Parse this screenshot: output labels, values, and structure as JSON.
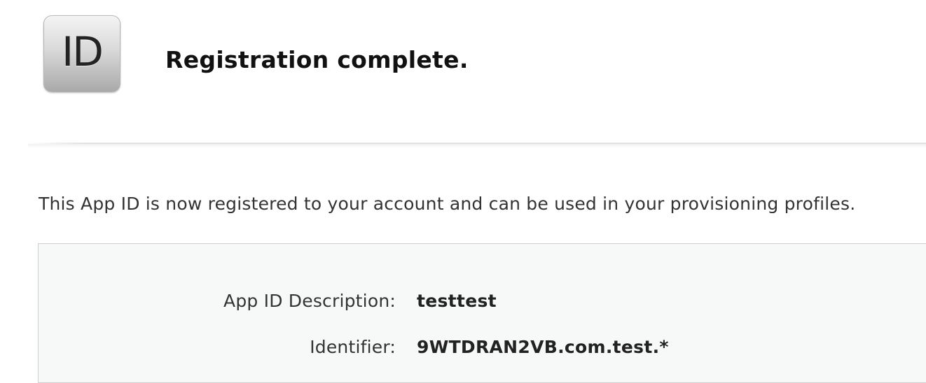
{
  "header": {
    "icon_label": "ID",
    "title": "Registration complete."
  },
  "main": {
    "intro_text": "This App ID is now registered to your account and can be used in your provisioning profiles.",
    "details": [
      {
        "label": "App ID Description:",
        "value": "testtest"
      },
      {
        "label": "Identifier:",
        "value": "9WTDRAN2VB.com.test.*"
      }
    ]
  }
}
